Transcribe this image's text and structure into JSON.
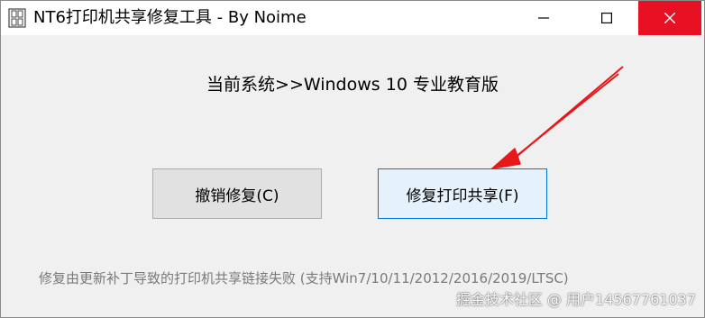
{
  "window": {
    "title": "NT6打印机共享修复工具 - By Noime",
    "controls": {
      "minimize_icon": "minimize-icon",
      "maximize_icon": "maximize-icon",
      "close_icon": "close-icon"
    }
  },
  "main": {
    "system_info": "当前系统>>Windows 10 专业教育版",
    "buttons": {
      "undo_label": "撤销修复(C)",
      "repair_label": "修复打印共享(F)"
    },
    "note": "修复由更新补丁导致的打印机共享链接失败 (支持Win7/10/11/2012/2016/2019/LTSC)"
  },
  "overlay": {
    "watermark": "掘金技术社区 @ 用户14567761037",
    "arrow_color": "#e8181a"
  },
  "colors": {
    "close_hover": "#e81123",
    "focus_border": "#0078d7"
  }
}
